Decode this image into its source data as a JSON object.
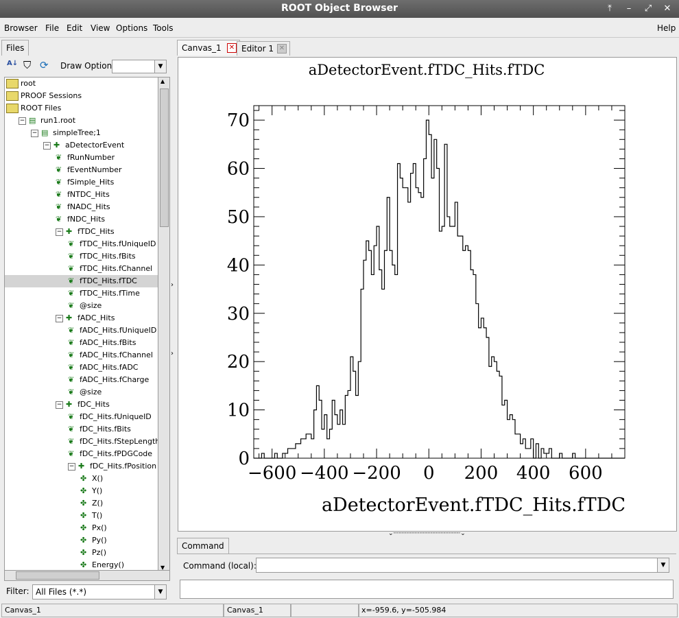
{
  "window": {
    "title": "ROOT Object Browser"
  },
  "menu": {
    "browser": "Browser",
    "file": "File",
    "edit": "Edit",
    "view": "View",
    "options": "Options",
    "tools": "Tools",
    "help": "Help"
  },
  "left": {
    "tab": "Files",
    "draw_option_label": "Draw Option:",
    "draw_option_value": "",
    "tree": [
      {
        "label": "root",
        "icon": "folder"
      },
      {
        "label": "PROOF Sessions",
        "icon": "folder"
      },
      {
        "label": "ROOT Files",
        "icon": "folder"
      },
      {
        "label": "run1.root",
        "icon": "file"
      },
      {
        "label": "simpleTree;1",
        "icon": "tree"
      },
      {
        "label": "aDetectorEvent",
        "icon": "branch"
      },
      {
        "label": "fRunNumber",
        "icon": "leaf"
      },
      {
        "label": "fEventNumber",
        "icon": "leaf"
      },
      {
        "label": "fSimple_Hits",
        "icon": "leaf"
      },
      {
        "label": "fNTDC_Hits",
        "icon": "leaf"
      },
      {
        "label": "fNADC_Hits",
        "icon": "leaf"
      },
      {
        "label": "fNDC_Hits",
        "icon": "leaf"
      },
      {
        "label": "fTDC_Hits",
        "icon": "branch"
      },
      {
        "label": "fTDC_Hits.fUniqueID",
        "icon": "leaf"
      },
      {
        "label": "fTDC_Hits.fBits",
        "icon": "leaf"
      },
      {
        "label": "fTDC_Hits.fChannel",
        "icon": "leaf"
      },
      {
        "label": "fTDC_Hits.fTDC",
        "icon": "leaf",
        "selected": true
      },
      {
        "label": "fTDC_Hits.fTime",
        "icon": "leaf"
      },
      {
        "label": "@size",
        "icon": "leaf"
      },
      {
        "label": "fADC_Hits",
        "icon": "branch"
      },
      {
        "label": "fADC_Hits.fUniqueID",
        "icon": "leaf"
      },
      {
        "label": "fADC_Hits.fBits",
        "icon": "leaf"
      },
      {
        "label": "fADC_Hits.fChannel",
        "icon": "leaf"
      },
      {
        "label": "fADC_Hits.fADC",
        "icon": "leaf"
      },
      {
        "label": "fADC_Hits.fCharge",
        "icon": "leaf"
      },
      {
        "label": "@size",
        "icon": "leaf"
      },
      {
        "label": "fDC_Hits",
        "icon": "branch"
      },
      {
        "label": "fDC_Hits.fUniqueID",
        "icon": "leaf"
      },
      {
        "label": "fDC_Hits.fBits",
        "icon": "leaf"
      },
      {
        "label": "fDC_Hits.fStepLength",
        "icon": "leaf"
      },
      {
        "label": "fDC_Hits.fPDGCode",
        "icon": "leaf"
      },
      {
        "label": "fDC_Hits.fPosition",
        "icon": "branch"
      },
      {
        "label": "X()",
        "icon": "func"
      },
      {
        "label": "Y()",
        "icon": "func"
      },
      {
        "label": "Z()",
        "icon": "func"
      },
      {
        "label": "T()",
        "icon": "func"
      },
      {
        "label": "Px()",
        "icon": "func"
      },
      {
        "label": "Py()",
        "icon": "func"
      },
      {
        "label": "Pz()",
        "icon": "func"
      },
      {
        "label": "Energy()",
        "icon": "func"
      }
    ],
    "filter_label": "Filter:",
    "filter_value": "All Files (*.*)"
  },
  "tabs": {
    "canvas": "Canvas_1",
    "editor": "Editor 1"
  },
  "command": {
    "tab": "Command",
    "label": "Command (local):",
    "value": ""
  },
  "status": {
    "s1": "Canvas_1",
    "s2": "Canvas_1",
    "s3": "",
    "s4": "x=-959.6, y=-505.984"
  },
  "chart_data": {
    "type": "bar",
    "title": "aDetectorEvent.fTDC_Hits.fTDC",
    "xlabel": "aDetectorEvent.fTDC_Hits.fTDC",
    "ylabel": "",
    "xlim": [
      -670,
      750
    ],
    "ylim": [
      0,
      73
    ],
    "xticks": [
      -600,
      -400,
      -200,
      0,
      200,
      400,
      600
    ],
    "yticks": [
      0,
      10,
      20,
      30,
      40,
      50,
      60,
      70
    ],
    "bin_width": 10,
    "x_start": -670,
    "values": [
      0,
      0,
      0,
      1,
      0,
      0,
      0,
      0,
      1,
      0,
      0,
      1,
      1,
      2,
      2,
      2,
      3,
      3,
      4,
      4,
      5,
      5,
      4,
      10,
      15,
      12,
      6,
      9,
      4,
      6,
      12,
      9,
      7,
      10,
      7,
      13,
      14,
      21,
      18,
      13,
      20,
      35,
      41,
      45,
      43,
      38,
      44,
      48,
      39,
      35,
      43,
      54,
      43,
      40,
      38,
      61,
      58,
      56,
      56,
      53,
      59,
      61,
      56,
      55,
      54,
      62,
      70,
      67,
      58,
      66,
      60,
      47,
      48,
      65,
      50,
      48,
      48,
      53,
      46,
      46,
      43,
      44,
      43,
      39,
      38,
      32,
      27,
      29,
      27,
      25,
      19,
      21,
      20,
      18,
      17,
      11,
      12,
      8,
      9,
      8,
      5,
      5,
      3,
      4,
      2,
      2,
      4,
      0,
      3,
      0,
      2,
      1,
      1,
      2,
      0,
      0,
      0,
      1,
      0,
      0,
      0,
      0,
      1,
      0,
      0,
      0,
      0,
      0,
      0,
      0,
      0,
      0,
      0,
      0,
      0,
      0,
      0,
      0,
      0,
      0,
      0,
      0
    ]
  }
}
